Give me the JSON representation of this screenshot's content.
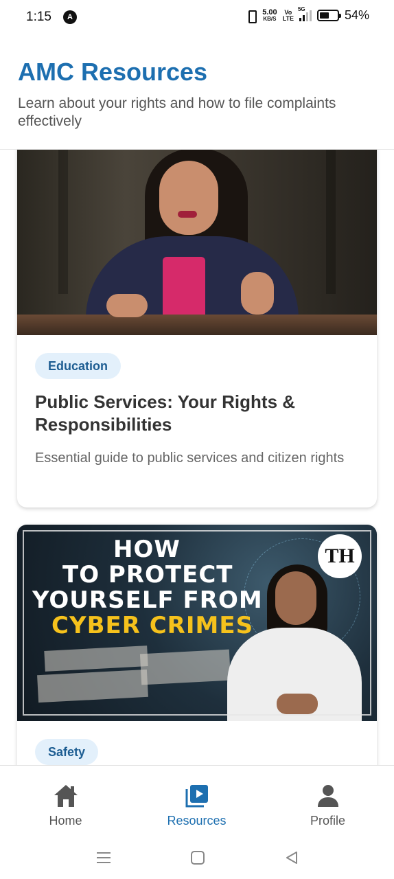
{
  "status_bar": {
    "time": "1:15",
    "network_speed": "5.00",
    "network_speed_unit": "KB/S",
    "volte_top": "Vo",
    "volte_bottom": "LTE",
    "network_type": "5G",
    "battery_percent": "54%",
    "battery_level": 0.54
  },
  "header": {
    "title": "AMC Resources",
    "subtitle": "Learn about your rights and how to file complaints effectively"
  },
  "resources": [
    {
      "category": "Education",
      "title": "Public Services: Your Rights & Responsibilities",
      "description": "Essential guide to public services and citizen rights"
    },
    {
      "category": "Safety",
      "thumbnail_text": {
        "line1": "HOW",
        "line2": "TO PROTECT",
        "line3": "YOURSELF FROM",
        "line4": "CYBER CRIMES",
        "logo": "TH"
      }
    }
  ],
  "bottom_nav": {
    "items": [
      {
        "label": "Home",
        "icon": "home-icon",
        "active": false
      },
      {
        "label": "Resources",
        "icon": "play-library-icon",
        "active": true
      },
      {
        "label": "Profile",
        "icon": "person-icon",
        "active": false
      }
    ]
  },
  "colors": {
    "accent": "#1d6fb0",
    "chip_bg": "#e3f0fb",
    "chip_text": "#1d5d92",
    "inactive_nav": "#555555",
    "headline_yellow": "#f6c21c"
  }
}
